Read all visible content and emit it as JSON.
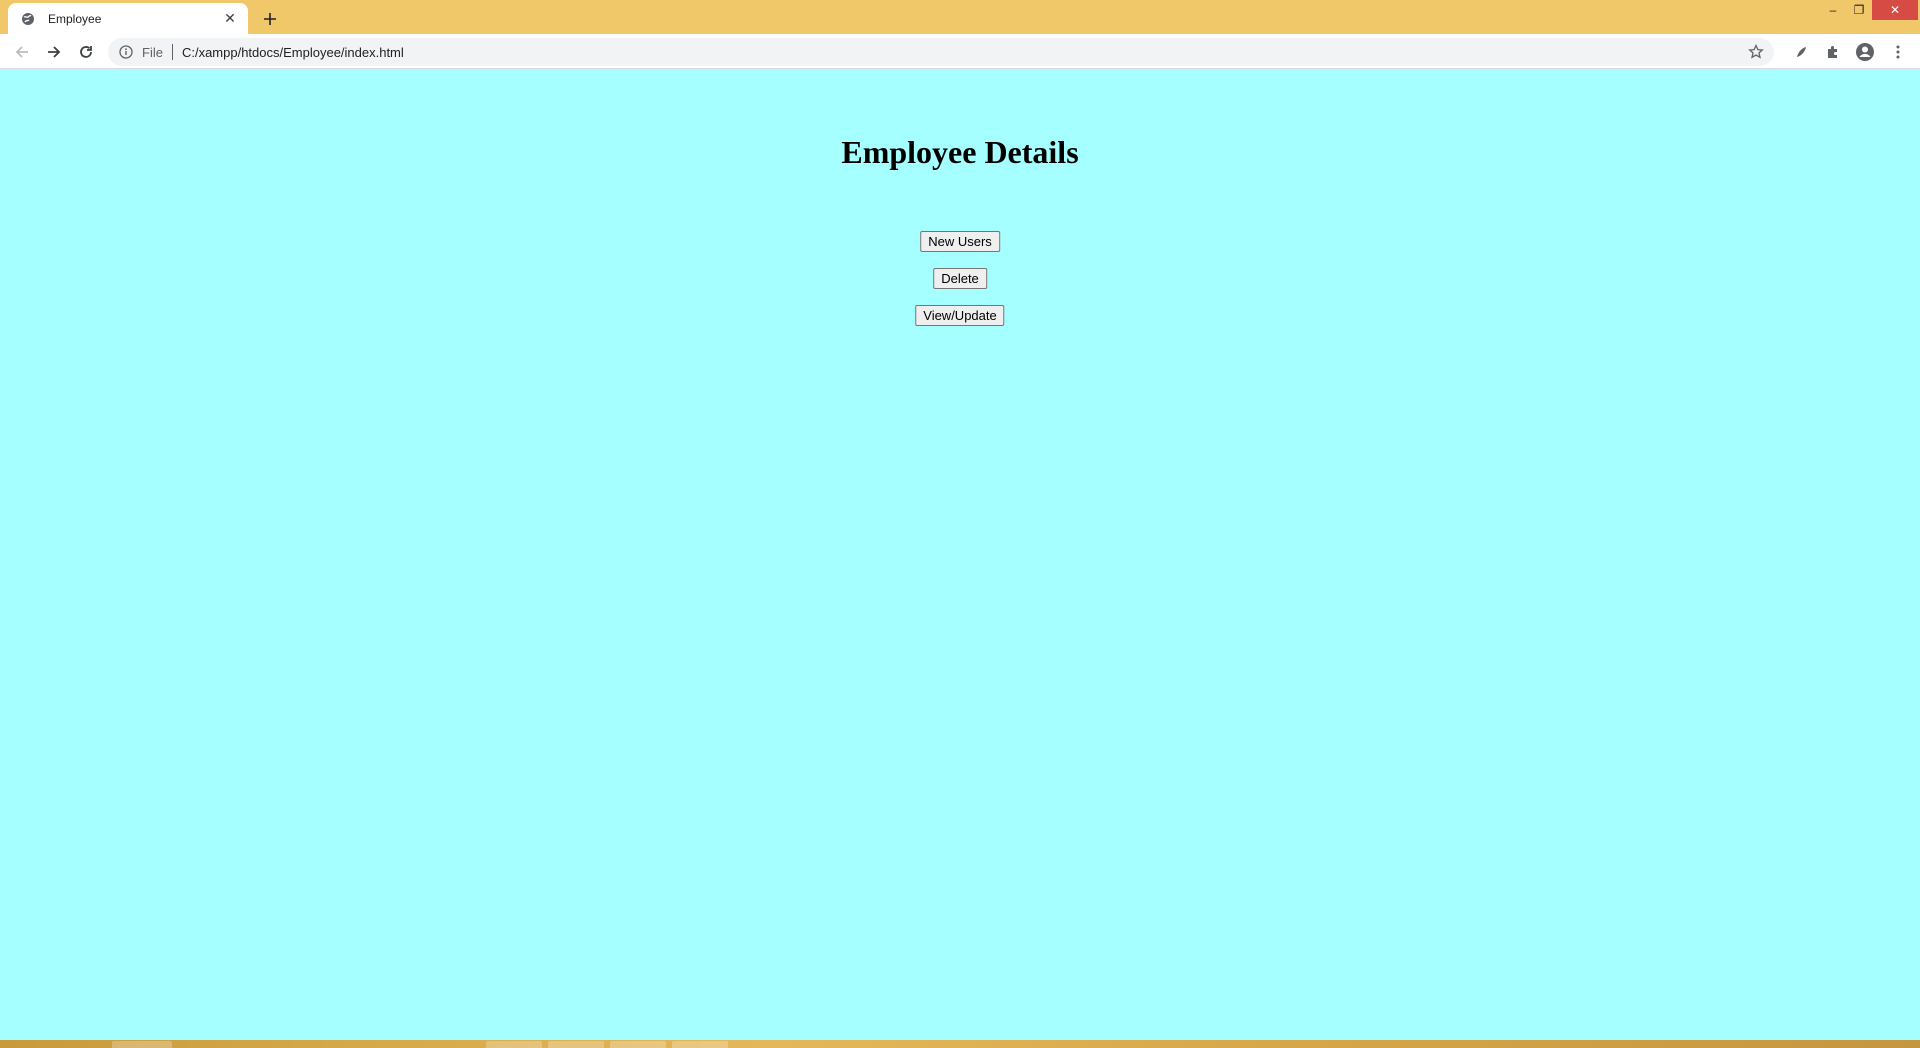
{
  "browser": {
    "tab": {
      "title": "Employee",
      "close_glyph": "✕"
    },
    "new_tab_glyph": "+",
    "window_controls": {
      "minimize": "–",
      "restore": "❐",
      "close": "✕"
    },
    "address": {
      "scheme": "File",
      "url": "C:/xampp/htdocs/Employee/index.html"
    }
  },
  "page": {
    "heading": "Employee Details",
    "buttons": {
      "new_users": "New Users",
      "delete": "Delete",
      "view_update": "View/Update"
    }
  },
  "colors": {
    "page_background": "#a5ffff",
    "tab_strip": "#f0c86a",
    "close_button": "#d64b44"
  },
  "icons": [
    "globe-icon",
    "close-icon",
    "plus-icon",
    "back-arrow-icon",
    "forward-arrow-icon",
    "reload-icon",
    "info-icon",
    "star-icon",
    "extension-feather-icon",
    "puzzle-icon",
    "profile-icon",
    "kebab-menu-icon"
  ]
}
